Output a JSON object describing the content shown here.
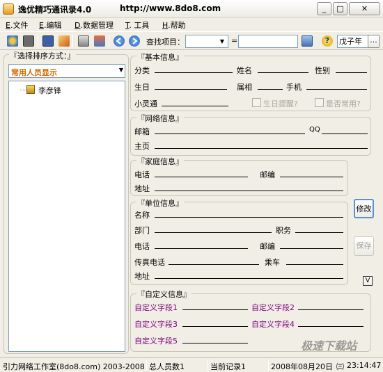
{
  "window": {
    "title": "逸优精巧通讯录4.0",
    "url": "http://www.8do8.com",
    "minimize": "_",
    "maximize": "□",
    "close": "✕"
  },
  "menu": [
    {
      "key": "E",
      "label": ".文件"
    },
    {
      "key": "E",
      "label": ".编辑"
    },
    {
      "key": "D",
      "label": ".数据管理"
    },
    {
      "key": "T",
      "label": ". 工具"
    },
    {
      "key": "H",
      "label": ".帮助"
    }
  ],
  "toolbar": {
    "search_label": "查找项目：",
    "search_field_value": "",
    "equals": "=",
    "search_value": "",
    "year_value": "戊子年",
    "more": "..."
  },
  "left": {
    "sort_label": "『选择排序方式：』",
    "sort_value": "常用人员显示",
    "tree": [
      {
        "label": "李彦锋"
      }
    ]
  },
  "basic": {
    "title": "『基本信息』",
    "category": "分类",
    "name": "姓名",
    "gender": "性别",
    "birthday": "生日",
    "zodiac": "属相",
    "phone": "手机",
    "pager": "小灵通",
    "birthday_remind": "生日提醒?",
    "is_common": "是否常用?"
  },
  "network": {
    "title": "『网络信息』",
    "email": "邮箱",
    "qq": "QQ",
    "homepage": "主页"
  },
  "family": {
    "title": "『家庭信息』",
    "phone": "电话",
    "zip": "邮编",
    "address": "地址"
  },
  "company": {
    "title": "『单位信息』",
    "name": "名称",
    "dept": "部门",
    "position": "职务",
    "phone": "电话",
    "zip": "邮编",
    "fax": "传真电话",
    "bus": "乘车",
    "address": "地址"
  },
  "custom": {
    "title": "『自定义信息』",
    "f1": "自定义字段1",
    "f2": "自定义字段2",
    "f3": "自定义字段3",
    "f4": "自定义字段4",
    "f5": "自定义字段5"
  },
  "buttons": {
    "modify": "修改",
    "save": "保存",
    "expand": "V"
  },
  "status": {
    "studio": "引力网络工作室(8do8.com) 2003-2008",
    "total": "总人员数1",
    "current": "当前记录1",
    "date": "2008年08月20日",
    "weekday": "㈢",
    "time": "23:14:47"
  },
  "watermark": "极速下载站"
}
